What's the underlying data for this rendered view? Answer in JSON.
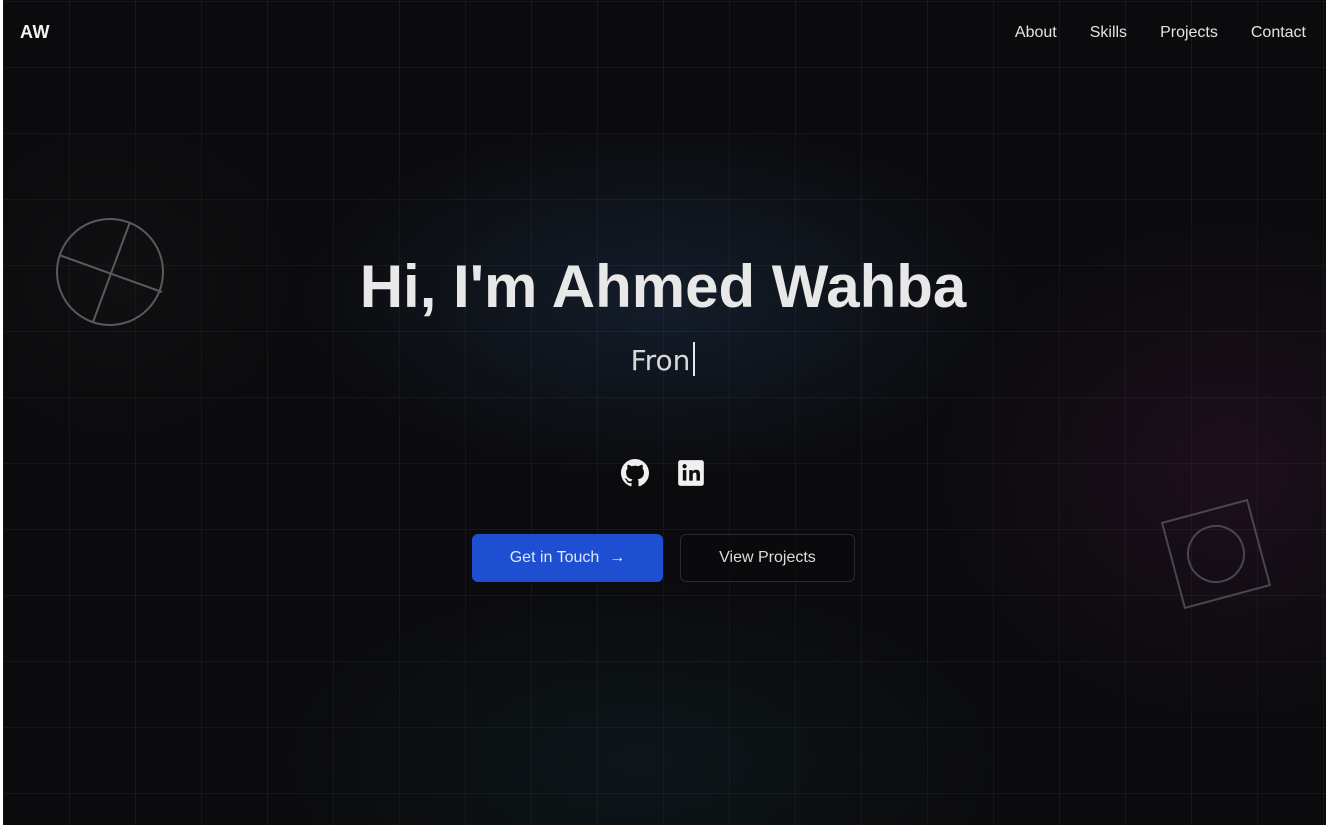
{
  "brand": {
    "logo": "AW"
  },
  "nav": {
    "items": [
      {
        "label": "About"
      },
      {
        "label": "Skills"
      },
      {
        "label": "Projects"
      },
      {
        "label": "Contact"
      }
    ]
  },
  "hero": {
    "title": "Hi, I'm Ahmed Wahba",
    "typing_text": "Fron"
  },
  "socials": [
    {
      "icon": "github-icon"
    },
    {
      "icon": "linkedin-icon"
    }
  ],
  "actions": {
    "primary_label": "Get in Touch",
    "primary_arrow": "→",
    "secondary_label": "View Projects"
  },
  "colors": {
    "background": "#0b0b0d",
    "accent": "#1d4fd0",
    "text": "#e8e8e8"
  }
}
